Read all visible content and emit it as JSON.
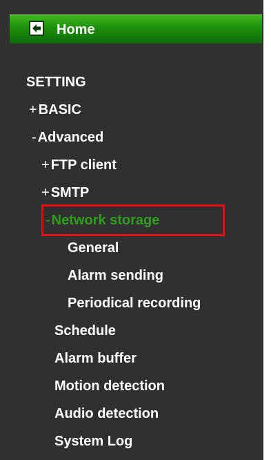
{
  "home": {
    "label": "Home",
    "icon": "back-arrow-icon"
  },
  "menu": {
    "section_title": "SETTING",
    "basic": {
      "prefix": "+",
      "label": "BASIC"
    },
    "advanced": {
      "prefix": "-",
      "label": "Advanced"
    },
    "ftp_client": {
      "prefix": "+",
      "label": "FTP client"
    },
    "smtp": {
      "prefix": "+",
      "label": "SMTP"
    },
    "network_storage": {
      "prefix": "-",
      "label": "Network storage"
    },
    "general": {
      "label": "General"
    },
    "alarm_sending": {
      "label": "Alarm sending"
    },
    "periodical_recording": {
      "label": "Periodical recording"
    },
    "schedule": {
      "label": "Schedule"
    },
    "alarm_buffer": {
      "label": "Alarm buffer"
    },
    "motion_detection": {
      "label": "Motion detection"
    },
    "audio_detection": {
      "label": "Audio detection"
    },
    "system_log": {
      "label": "System Log"
    }
  },
  "colors": {
    "panel_background": "#303030",
    "home_bar_green": "#1f8f0e",
    "active_item_green": "#2f9e1c",
    "highlight_red": "#e01010",
    "text": "#ffffff"
  }
}
